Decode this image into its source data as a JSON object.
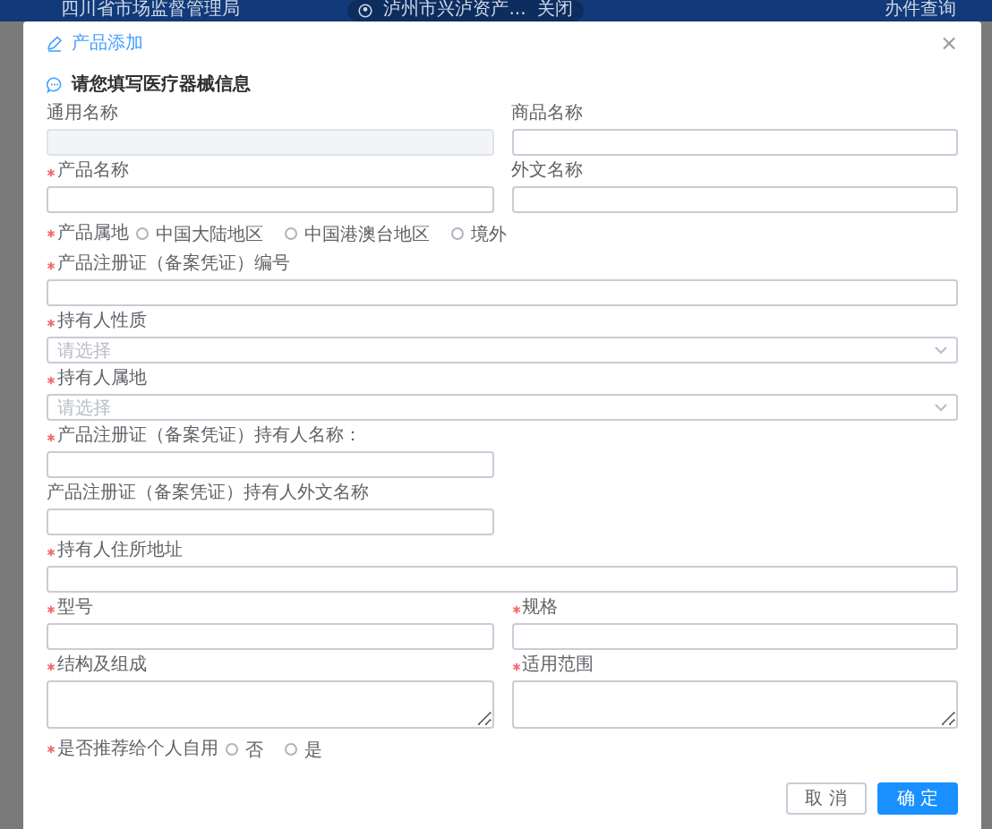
{
  "header": {
    "agency": "四川省市场监督管理局",
    "account": "泸州市兴泸资产...",
    "account_close": "关闭",
    "link": "办件查询"
  },
  "dialog": {
    "title": "产品添加",
    "close": "×",
    "section_title": "请您填写医疗器械信息",
    "rows": [
      {
        "fields": [
          {
            "kind": "input",
            "label": "通用名称",
            "required": false,
            "disabled": true,
            "full_width": false
          },
          {
            "kind": "input",
            "label": "商品名称",
            "required": false,
            "disabled": false,
            "full_width": false
          }
        ]
      },
      {
        "fields": [
          {
            "kind": "input",
            "label": "产品名称",
            "required": true,
            "disabled": false,
            "full_width": false
          },
          {
            "kind": "input",
            "label": "外文名称",
            "required": false,
            "disabled": false,
            "full_width": false
          }
        ]
      },
      {
        "fields": [
          {
            "kind": "radio",
            "label": "产品属地",
            "required": true,
            "options": [
              {
                "label": "中国大陆地区",
                "selected": false
              },
              {
                "label": "中国港澳台地区",
                "selected": false
              },
              {
                "label": "境外",
                "selected": false
              }
            ]
          }
        ]
      },
      {
        "fields": [
          {
            "kind": "input",
            "label": "产品注册证（备案凭证）编号",
            "required": true,
            "disabled": false,
            "full_width": true
          }
        ]
      },
      {
        "fields": [
          {
            "kind": "select",
            "label": "持有人性质",
            "required": true,
            "placeholder": "请选择",
            "full_width": true
          }
        ]
      },
      {
        "fields": [
          {
            "kind": "select",
            "label": "持有人属地",
            "required": true,
            "placeholder": "请选择",
            "full_width": true
          }
        ]
      },
      {
        "fields": [
          {
            "kind": "input",
            "label": "产品注册证（备案凭证）持有人名称：",
            "required": true,
            "disabled": false,
            "full_width": false
          }
        ]
      },
      {
        "fields": [
          {
            "kind": "input",
            "label": "产品注册证（备案凭证）持有人外文名称",
            "required": false,
            "disabled": false,
            "full_width": false
          }
        ]
      },
      {
        "fields": [
          {
            "kind": "input",
            "label": "持有人住所地址",
            "required": true,
            "disabled": false,
            "full_width": true
          }
        ]
      },
      {
        "fields": [
          {
            "kind": "input",
            "label": "型号",
            "required": true,
            "disabled": false,
            "full_width": false
          },
          {
            "kind": "input",
            "label": "规格",
            "required": true,
            "disabled": false,
            "full_width": false
          }
        ]
      },
      {
        "fields": [
          {
            "kind": "textarea",
            "label": "结构及组成",
            "required": true,
            "full_width": false
          },
          {
            "kind": "textarea",
            "label": "适用范围",
            "required": true,
            "full_width": false
          }
        ]
      },
      {
        "fields": [
          {
            "kind": "radio",
            "label": "是否推荐给个人自用",
            "required": true,
            "options": [
              {
                "label": "否",
                "selected": false
              },
              {
                "label": "是",
                "selected": false
              }
            ]
          }
        ]
      }
    ],
    "buttons": [
      {
        "label": "取 消",
        "kind": "secondary"
      },
      {
        "label": "确 定",
        "kind": "primary"
      }
    ]
  }
}
